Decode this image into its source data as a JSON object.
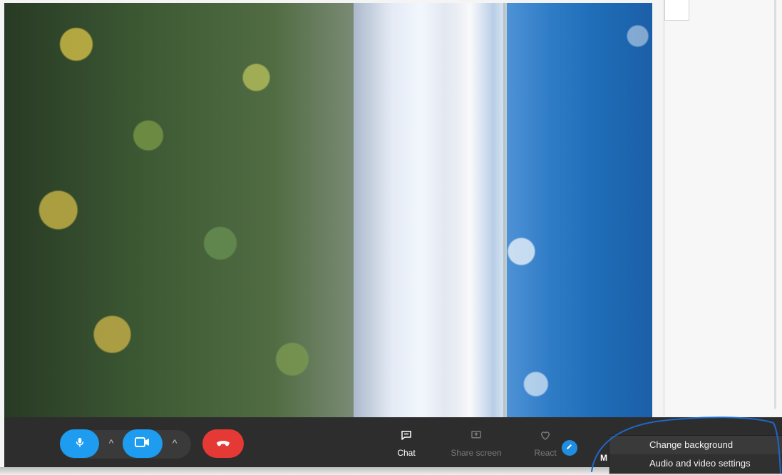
{
  "toolbar": {
    "chat_label": "Chat",
    "share_label": "Share screen",
    "react_label": "React",
    "more_label": "M"
  },
  "menu": {
    "items": [
      {
        "label": "Change background"
      },
      {
        "label": "Audio and video settings"
      }
    ]
  },
  "colors": {
    "accent_blue": "#1e9cf0",
    "end_call_red": "#e53935",
    "bar_bg": "#2d2d2d",
    "menu_bg": "#3a3a3a"
  },
  "icons": {
    "mic": "mic-icon",
    "camera": "camera-icon",
    "hangup": "phone-hangup-icon",
    "chat": "chat-icon",
    "share": "share-screen-icon",
    "react": "heart-icon",
    "pen": "pencil-icon"
  }
}
